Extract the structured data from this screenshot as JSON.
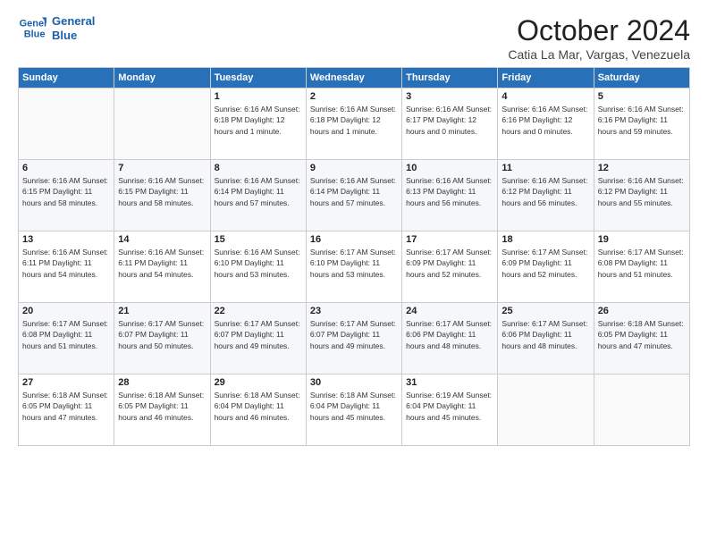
{
  "logo": {
    "line1": "General",
    "line2": "Blue"
  },
  "title": "October 2024",
  "location": "Catia La Mar, Vargas, Venezuela",
  "days_of_week": [
    "Sunday",
    "Monday",
    "Tuesday",
    "Wednesday",
    "Thursday",
    "Friday",
    "Saturday"
  ],
  "weeks": [
    [
      {
        "day": "",
        "info": ""
      },
      {
        "day": "",
        "info": ""
      },
      {
        "day": "1",
        "info": "Sunrise: 6:16 AM\nSunset: 6:18 PM\nDaylight: 12 hours\nand 1 minute."
      },
      {
        "day": "2",
        "info": "Sunrise: 6:16 AM\nSunset: 6:18 PM\nDaylight: 12 hours\nand 1 minute."
      },
      {
        "day": "3",
        "info": "Sunrise: 6:16 AM\nSunset: 6:17 PM\nDaylight: 12 hours\nand 0 minutes."
      },
      {
        "day": "4",
        "info": "Sunrise: 6:16 AM\nSunset: 6:16 PM\nDaylight: 12 hours\nand 0 minutes."
      },
      {
        "day": "5",
        "info": "Sunrise: 6:16 AM\nSunset: 6:16 PM\nDaylight: 11 hours\nand 59 minutes."
      }
    ],
    [
      {
        "day": "6",
        "info": "Sunrise: 6:16 AM\nSunset: 6:15 PM\nDaylight: 11 hours\nand 58 minutes."
      },
      {
        "day": "7",
        "info": "Sunrise: 6:16 AM\nSunset: 6:15 PM\nDaylight: 11 hours\nand 58 minutes."
      },
      {
        "day": "8",
        "info": "Sunrise: 6:16 AM\nSunset: 6:14 PM\nDaylight: 11 hours\nand 57 minutes."
      },
      {
        "day": "9",
        "info": "Sunrise: 6:16 AM\nSunset: 6:14 PM\nDaylight: 11 hours\nand 57 minutes."
      },
      {
        "day": "10",
        "info": "Sunrise: 6:16 AM\nSunset: 6:13 PM\nDaylight: 11 hours\nand 56 minutes."
      },
      {
        "day": "11",
        "info": "Sunrise: 6:16 AM\nSunset: 6:12 PM\nDaylight: 11 hours\nand 56 minutes."
      },
      {
        "day": "12",
        "info": "Sunrise: 6:16 AM\nSunset: 6:12 PM\nDaylight: 11 hours\nand 55 minutes."
      }
    ],
    [
      {
        "day": "13",
        "info": "Sunrise: 6:16 AM\nSunset: 6:11 PM\nDaylight: 11 hours\nand 54 minutes."
      },
      {
        "day": "14",
        "info": "Sunrise: 6:16 AM\nSunset: 6:11 PM\nDaylight: 11 hours\nand 54 minutes."
      },
      {
        "day": "15",
        "info": "Sunrise: 6:16 AM\nSunset: 6:10 PM\nDaylight: 11 hours\nand 53 minutes."
      },
      {
        "day": "16",
        "info": "Sunrise: 6:17 AM\nSunset: 6:10 PM\nDaylight: 11 hours\nand 53 minutes."
      },
      {
        "day": "17",
        "info": "Sunrise: 6:17 AM\nSunset: 6:09 PM\nDaylight: 11 hours\nand 52 minutes."
      },
      {
        "day": "18",
        "info": "Sunrise: 6:17 AM\nSunset: 6:09 PM\nDaylight: 11 hours\nand 52 minutes."
      },
      {
        "day": "19",
        "info": "Sunrise: 6:17 AM\nSunset: 6:08 PM\nDaylight: 11 hours\nand 51 minutes."
      }
    ],
    [
      {
        "day": "20",
        "info": "Sunrise: 6:17 AM\nSunset: 6:08 PM\nDaylight: 11 hours\nand 51 minutes."
      },
      {
        "day": "21",
        "info": "Sunrise: 6:17 AM\nSunset: 6:07 PM\nDaylight: 11 hours\nand 50 minutes."
      },
      {
        "day": "22",
        "info": "Sunrise: 6:17 AM\nSunset: 6:07 PM\nDaylight: 11 hours\nand 49 minutes."
      },
      {
        "day": "23",
        "info": "Sunrise: 6:17 AM\nSunset: 6:07 PM\nDaylight: 11 hours\nand 49 minutes."
      },
      {
        "day": "24",
        "info": "Sunrise: 6:17 AM\nSunset: 6:06 PM\nDaylight: 11 hours\nand 48 minutes."
      },
      {
        "day": "25",
        "info": "Sunrise: 6:17 AM\nSunset: 6:06 PM\nDaylight: 11 hours\nand 48 minutes."
      },
      {
        "day": "26",
        "info": "Sunrise: 6:18 AM\nSunset: 6:05 PM\nDaylight: 11 hours\nand 47 minutes."
      }
    ],
    [
      {
        "day": "27",
        "info": "Sunrise: 6:18 AM\nSunset: 6:05 PM\nDaylight: 11 hours\nand 47 minutes."
      },
      {
        "day": "28",
        "info": "Sunrise: 6:18 AM\nSunset: 6:05 PM\nDaylight: 11 hours\nand 46 minutes."
      },
      {
        "day": "29",
        "info": "Sunrise: 6:18 AM\nSunset: 6:04 PM\nDaylight: 11 hours\nand 46 minutes."
      },
      {
        "day": "30",
        "info": "Sunrise: 6:18 AM\nSunset: 6:04 PM\nDaylight: 11 hours\nand 45 minutes."
      },
      {
        "day": "31",
        "info": "Sunrise: 6:19 AM\nSunset: 6:04 PM\nDaylight: 11 hours\nand 45 minutes."
      },
      {
        "day": "",
        "info": ""
      },
      {
        "day": "",
        "info": ""
      }
    ]
  ]
}
